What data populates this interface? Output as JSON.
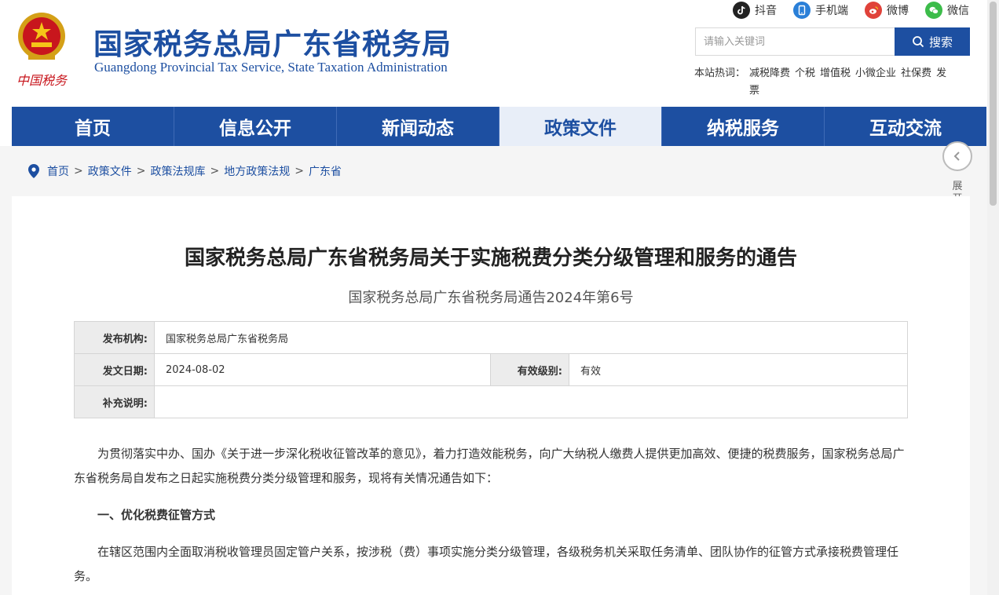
{
  "header": {
    "title": "国家税务总局广东省税务局",
    "subtitle": "Guangdong Provincial Tax Service, State Taxation Administration",
    "logo_text": "中国税务",
    "social": [
      {
        "label": "抖音",
        "icon": "douyin-icon",
        "color": "#222222"
      },
      {
        "label": "手机端",
        "icon": "mobile-icon",
        "color": "#2a7fd8"
      },
      {
        "label": "微博",
        "icon": "weibo-icon",
        "color": "#e0423a"
      },
      {
        "label": "微信",
        "icon": "wechat-icon",
        "color": "#3cbc4a"
      }
    ],
    "search": {
      "placeholder": "请输入关键词",
      "button": "搜索"
    },
    "hot": {
      "label": "本站热词：",
      "words": [
        "减税降费",
        "个税",
        "增值税",
        "小微企业",
        "社保费",
        "发票"
      ]
    }
  },
  "nav": {
    "items": [
      "首页",
      "信息公开",
      "新闻动态",
      "政策文件",
      "纳税服务",
      "互动交流"
    ],
    "active_index": 3
  },
  "breadcrumb": [
    "首页",
    "政策文件",
    "政策法规库",
    "地方政策法规",
    "广东省"
  ],
  "side_toggle": {
    "label": "展开边栏"
  },
  "document": {
    "title": "国家税务总局广东省税务局关于实施税费分类分级管理和服务的通告",
    "number": "国家税务总局广东省税务局通告2024年第6号",
    "meta": {
      "publisher_label": "发布机构:",
      "publisher": "国家税务总局广东省税务局",
      "date_label": "发文日期:",
      "date": "2024-08-02",
      "level_label": "有效级别:",
      "level": "有效",
      "note_label": "补充说明:",
      "note": ""
    },
    "paragraphs": [
      "为贯彻落实中办、国办《关于进一步深化税收征管改革的意见》，着力打造效能税务，向广大纳税人缴费人提供更加高效、便捷的税费服务，国家税务总局广东省税务局自发布之日起实施税费分类分级管理和服务，现将有关情况通告如下：",
      "一、优化税费征管方式",
      "在辖区范围内全面取消税收管理员固定管户关系，按涉税（费）事项实施分类分级管理，各级税务机关采取任务清单、团队协作的征管方式承接税费管理任务。"
    ]
  },
  "colors": {
    "primary": "#1d4fa1",
    "nav_active_bg": "#e8eef8",
    "page_bg": "#f5f5f5"
  }
}
